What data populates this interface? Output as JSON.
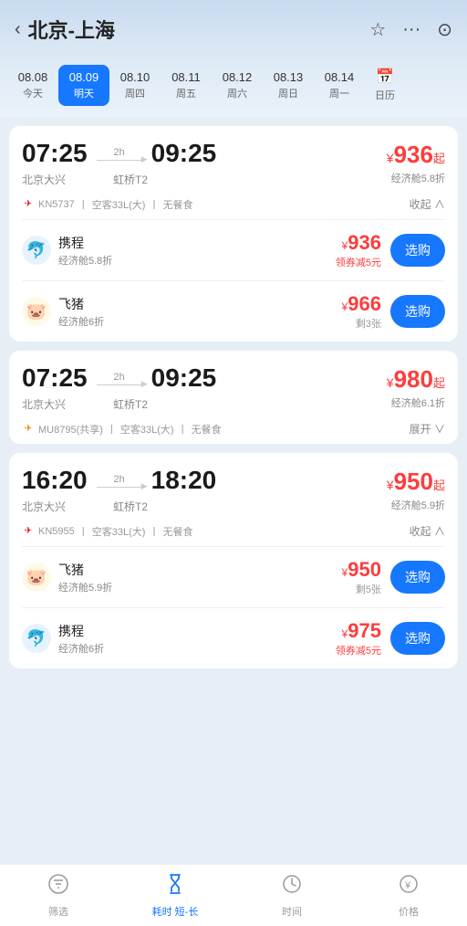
{
  "header": {
    "back_icon": "‹",
    "title": "北京-上海",
    "star_icon": "☆",
    "more_icon": "···",
    "target_icon": "⊙"
  },
  "date_bar": {
    "items": [
      {
        "date": "08.08",
        "week": "今天",
        "active": false
      },
      {
        "date": "08.09",
        "week": "明天",
        "active": true
      },
      {
        "date": "08.10",
        "week": "周四",
        "active": false
      },
      {
        "date": "08.11",
        "week": "周五",
        "active": false
      },
      {
        "date": "08.12",
        "week": "周六",
        "active": false
      },
      {
        "date": "08.13",
        "week": "周日",
        "active": false
      },
      {
        "date": "08.14",
        "week": "周一",
        "active": false
      }
    ],
    "calendar_label": "日历"
  },
  "flights": [
    {
      "id": "f1",
      "depart_time": "07:25",
      "arrive_time": "09:25",
      "duration": "2h",
      "depart_city": "北京大兴",
      "arrive_city": "虹桥T2",
      "price": "936",
      "price_suffix": "起",
      "discount": "经济舱5.8折",
      "flight_no": "KN5737",
      "plane": "空客33L(大)",
      "meal": "无餐食",
      "toggle": "收起 ∧",
      "expanded": true,
      "providers": [
        {
          "name": "携程",
          "logo": "🐬",
          "discount": "经济舱5.8折",
          "price": "936",
          "sub": "领券减5元",
          "sub_color": "red",
          "btn": "选购"
        },
        {
          "name": "飞猪",
          "logo": "🐷",
          "discount": "经济舱6折",
          "price": "966",
          "sub": "剩3张",
          "sub_color": "gray",
          "btn": "选购"
        }
      ]
    },
    {
      "id": "f2",
      "depart_time": "07:25",
      "arrive_time": "09:25",
      "duration": "2h",
      "depart_city": "北京大兴",
      "arrive_city": "虹桥T2",
      "price": "980",
      "price_suffix": "起",
      "discount": "经济舱6.1折",
      "flight_no": "MU8795(共享)",
      "plane": "空客33L(大)",
      "meal": "无餐食",
      "toggle": "展开 ∨",
      "expanded": false,
      "providers": []
    },
    {
      "id": "f3",
      "depart_time": "16:20",
      "arrive_time": "18:20",
      "duration": "2h",
      "depart_city": "北京大兴",
      "arrive_city": "虹桥T2",
      "price": "950",
      "price_suffix": "起",
      "discount": "经济舱5.9折",
      "flight_no": "KN5955",
      "plane": "空客33L(大)",
      "meal": "无餐食",
      "toggle": "收起 ∧",
      "expanded": true,
      "providers": [
        {
          "name": "飞猪",
          "logo": "🐷",
          "discount": "经济舱5.9折",
          "price": "950",
          "sub": "剩5张",
          "sub_color": "gray",
          "btn": "选购"
        },
        {
          "name": "携程",
          "logo": "🐬",
          "discount": "经济舱6折",
          "price": "975",
          "sub": "领券减5元",
          "sub_color": "red",
          "btn": "选购"
        }
      ]
    }
  ],
  "bottom_nav": [
    {
      "id": "filter",
      "icon": "⊕",
      "label": "筛选",
      "active": false
    },
    {
      "id": "duration",
      "icon": "⏳",
      "label": "耗时 短-长",
      "active": true
    },
    {
      "id": "time",
      "icon": "🕐",
      "label": "时间",
      "active": false
    },
    {
      "id": "price",
      "icon": "¥",
      "label": "价格",
      "active": false
    }
  ]
}
